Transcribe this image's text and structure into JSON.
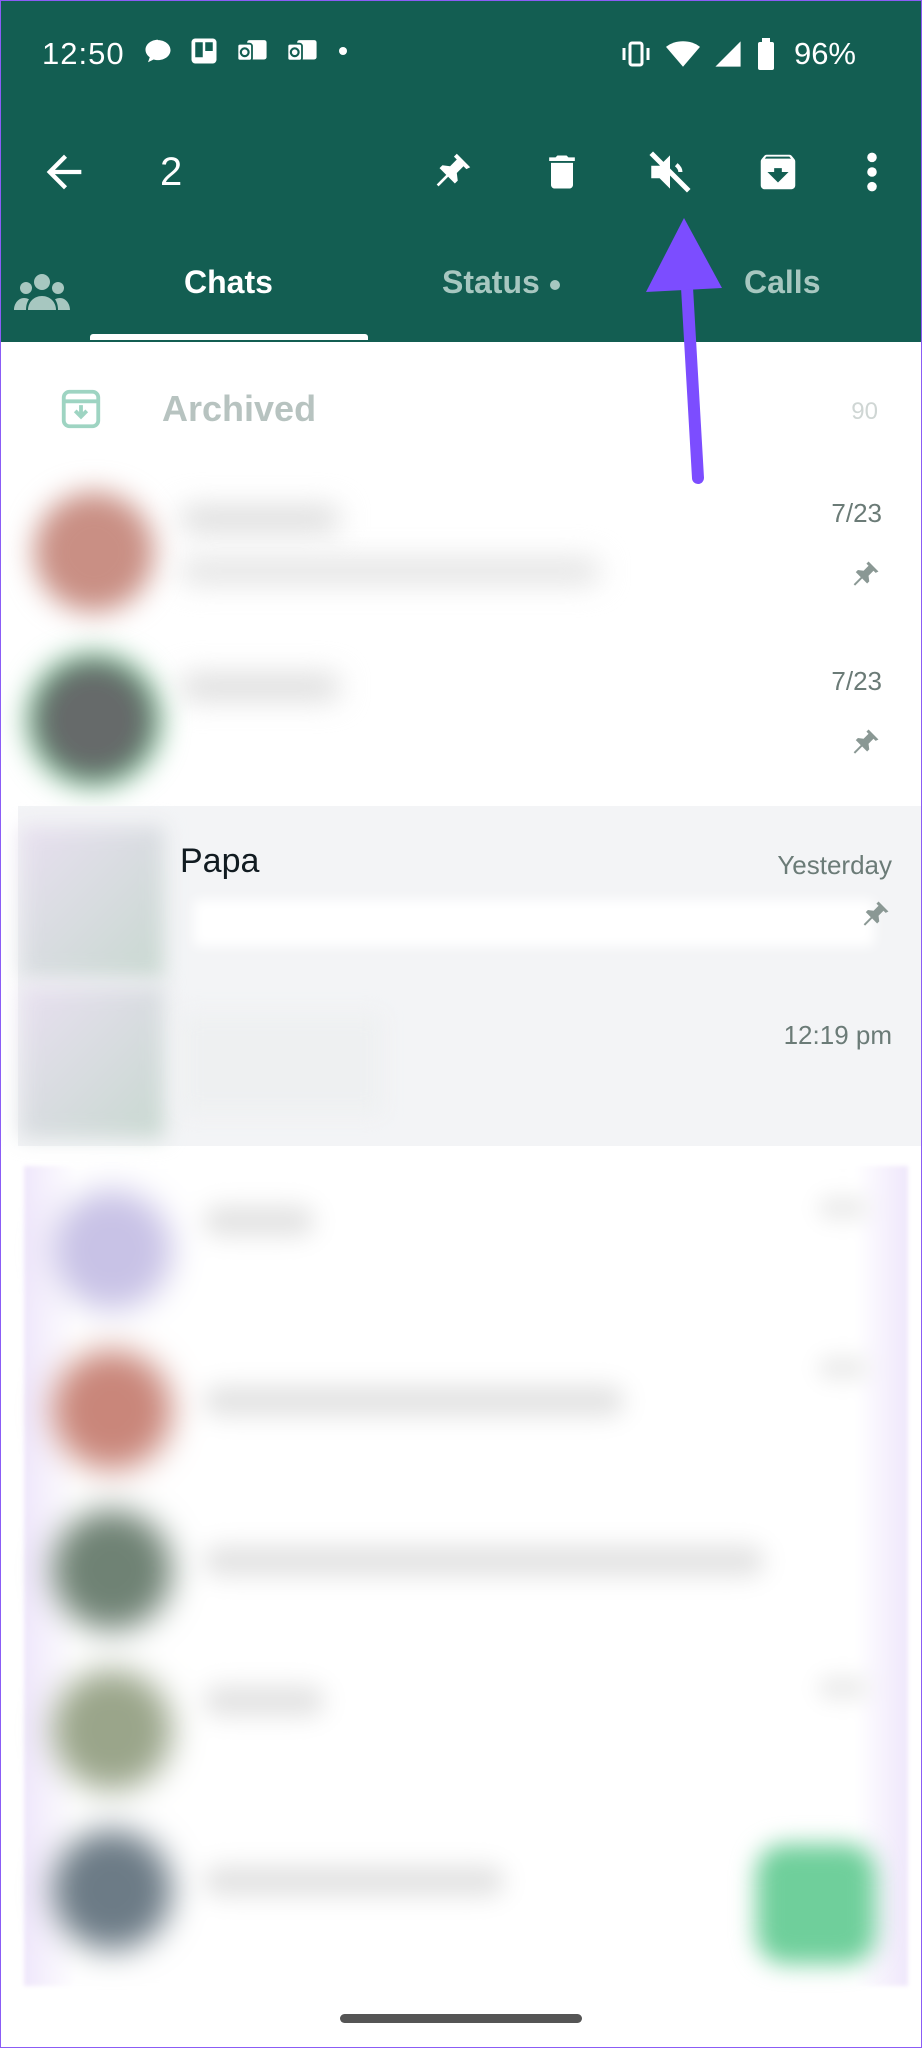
{
  "status_bar": {
    "time": "12:50",
    "battery": "96%",
    "left_icons": [
      "chat-bubble-icon",
      "trello-icon",
      "outlook-icon",
      "outlook-icon",
      "dot-icon"
    ],
    "right_icons": [
      "vibrate-icon",
      "wifi-icon",
      "cell-signal-icon",
      "battery-icon"
    ]
  },
  "action_bar": {
    "selected_count": "2",
    "actions": [
      "pin-icon",
      "delete-icon",
      "mute-icon",
      "archive-icon",
      "more-icon"
    ]
  },
  "tabs": [
    {
      "label": "Chats",
      "active": true
    },
    {
      "label": "Status",
      "active": false
    },
    {
      "label": "Calls",
      "active": false
    }
  ],
  "archived": {
    "label": "Archived",
    "count": "90"
  },
  "chats": [
    {
      "name": "",
      "date": "7/23",
      "pinned": true
    },
    {
      "name": "",
      "date": "7/23",
      "pinned": true
    },
    {
      "name": "Papa",
      "date": "Yesterday",
      "pinned": true,
      "selected": true
    },
    {
      "name": "",
      "date": "12:19 pm",
      "pinned": false,
      "selected": true
    }
  ],
  "colors": {
    "header_bg": "#135e52",
    "selected_bg": "#f3f4f6",
    "annotation_arrow": "#7c4dff"
  }
}
